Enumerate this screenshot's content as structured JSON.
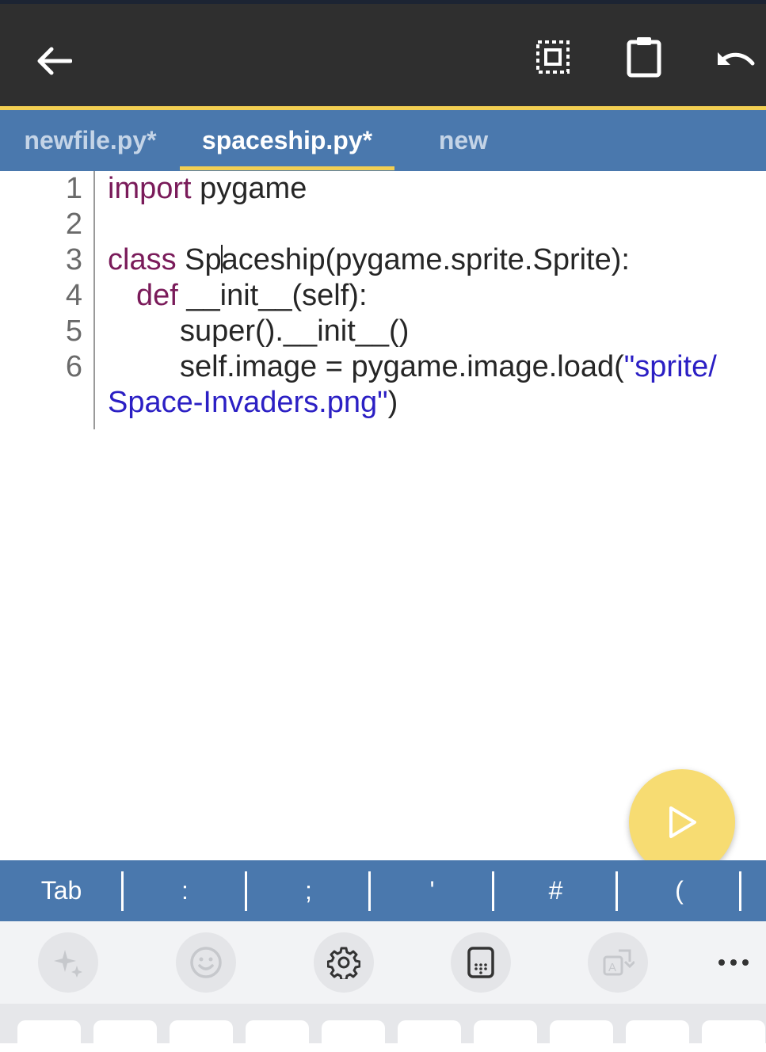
{
  "toolbar": {
    "back_icon": "arrow-left-icon",
    "icons": [
      "select-all-icon",
      "clipboard-icon",
      "undo-icon"
    ]
  },
  "tabs": [
    {
      "label": "newfile.py*",
      "active": false
    },
    {
      "label": "spaceship.py*",
      "active": true
    },
    {
      "label": "new",
      "active": false
    }
  ],
  "editor": {
    "line_numbers": [
      "1",
      "2",
      "3",
      "4",
      "5",
      "6"
    ],
    "lines": {
      "l1_kw": "import",
      "l1_rest": " pygame",
      "l3_kw": "class",
      "l3_a": " Sp",
      "l3_b": "aceship(pygame.sprite.Sprite):",
      "l4_kw": "def",
      "l4_rest": " __init__(self):",
      "l5": "super().__init__()",
      "l6_a": "self.image = pygame.image.load(",
      "l6_str1": "\"sprite/",
      "l7_str2": "Space-Invaders.png\"",
      "l7_rest": ")"
    }
  },
  "run_button_icon": "play-icon",
  "symbols": [
    "Tab",
    ":",
    ";",
    "'",
    "#",
    "("
  ],
  "keyboard_tools": [
    "sparkle-icon",
    "emoji-icon",
    "settings-icon",
    "keypad-icon",
    "translate-icon",
    "more-icon"
  ],
  "colors": {
    "accent": "#f2cf52",
    "bar": "#4a78ad",
    "toolbar": "#2f2f2f",
    "keyword": "#7a1b5a",
    "string": "#2b1fc4"
  }
}
